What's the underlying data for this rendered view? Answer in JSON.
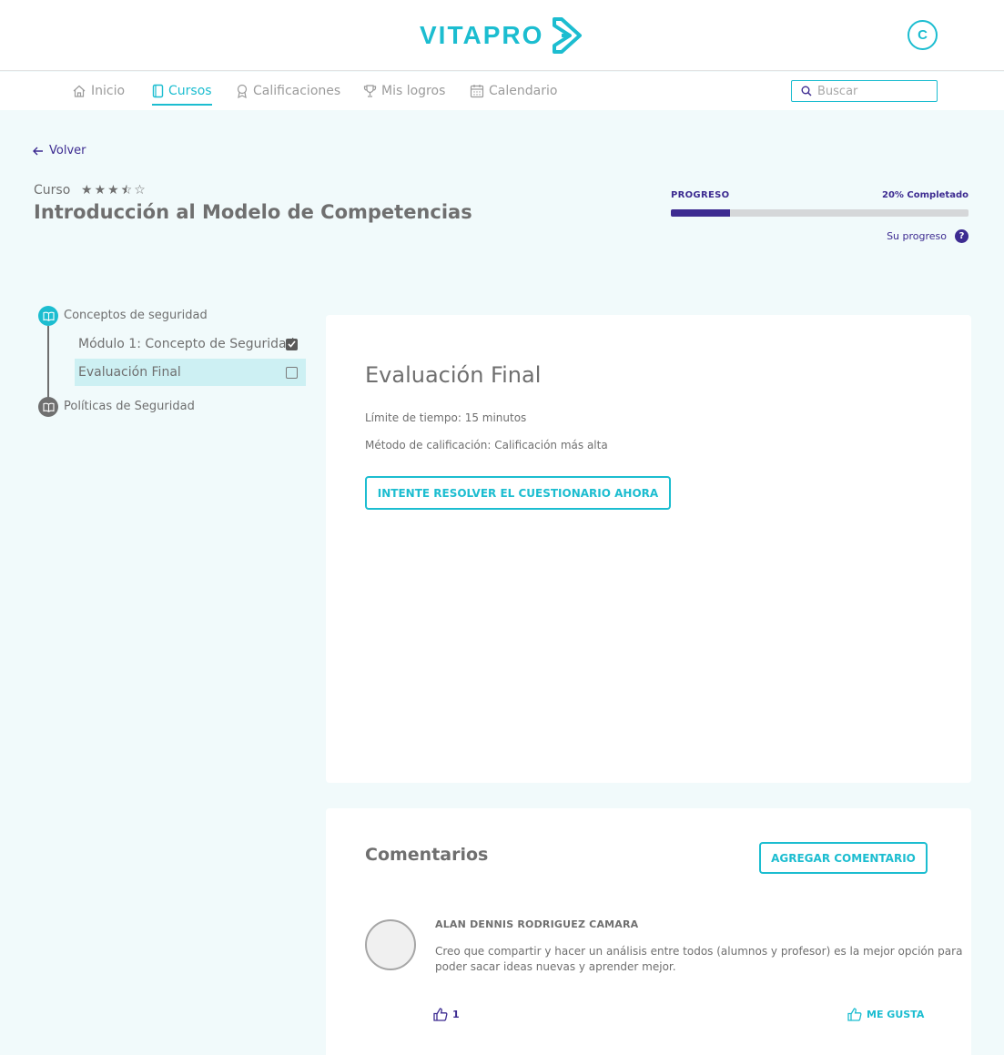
{
  "brand": {
    "name": "VITAPRO",
    "accent": "#1cbdd0",
    "secondary": "#3d2b91"
  },
  "user": {
    "initial": "C"
  },
  "nav": {
    "items": [
      {
        "label": "Inicio",
        "icon": "home-icon",
        "active": false
      },
      {
        "label": "Cursos",
        "icon": "book-icon",
        "active": true
      },
      {
        "label": "Calificaciones",
        "icon": "award-icon",
        "active": false
      },
      {
        "label": "Mis logros",
        "icon": "trophy-icon",
        "active": false
      },
      {
        "label": "Calendario",
        "icon": "calendar-icon",
        "active": false
      }
    ],
    "search_placeholder": "Buscar"
  },
  "back_label": "Volver",
  "course": {
    "label": "Curso",
    "rating": 3.5,
    "rating_max": 5,
    "title": "Introducción al Modelo de Competencias"
  },
  "progress": {
    "label": "PROGRESO",
    "percent": 20,
    "percent_text": "20% Completado",
    "help_label": "Su progreso"
  },
  "sidebar": {
    "sections": [
      {
        "title": "Conceptos de seguridad",
        "icon": "book-open-icon",
        "modules": [
          {
            "label": "Módulo 1: Concepto de Seguridad",
            "completed": true,
            "selected": false
          },
          {
            "label": "Evaluación Final",
            "completed": false,
            "selected": true
          }
        ]
      },
      {
        "title": "Políticas de Seguridad",
        "icon": "book-open-icon",
        "modules": []
      }
    ]
  },
  "evaluation": {
    "title": "Evaluación Final",
    "time_limit": "Límite de tiempo: 15 minutos",
    "grading_method": "Método de calificación: Calificación más alta",
    "button_label": "INTENTE RESOLVER EL CUESTIONARIO AHORA"
  },
  "comments": {
    "title": "Comentarios",
    "add_button": "AGREGAR COMENTARIO",
    "items": [
      {
        "author": "ALAN DENNIS RODRIGUEZ CAMARA",
        "text": "Creo que compartir y hacer un análisis entre todos (alumnos y profesor) es la mejor opción para poder sacar ideas nuevas y aprender mejor.",
        "likes": "1",
        "like_label": "ME GUSTA"
      }
    ]
  }
}
